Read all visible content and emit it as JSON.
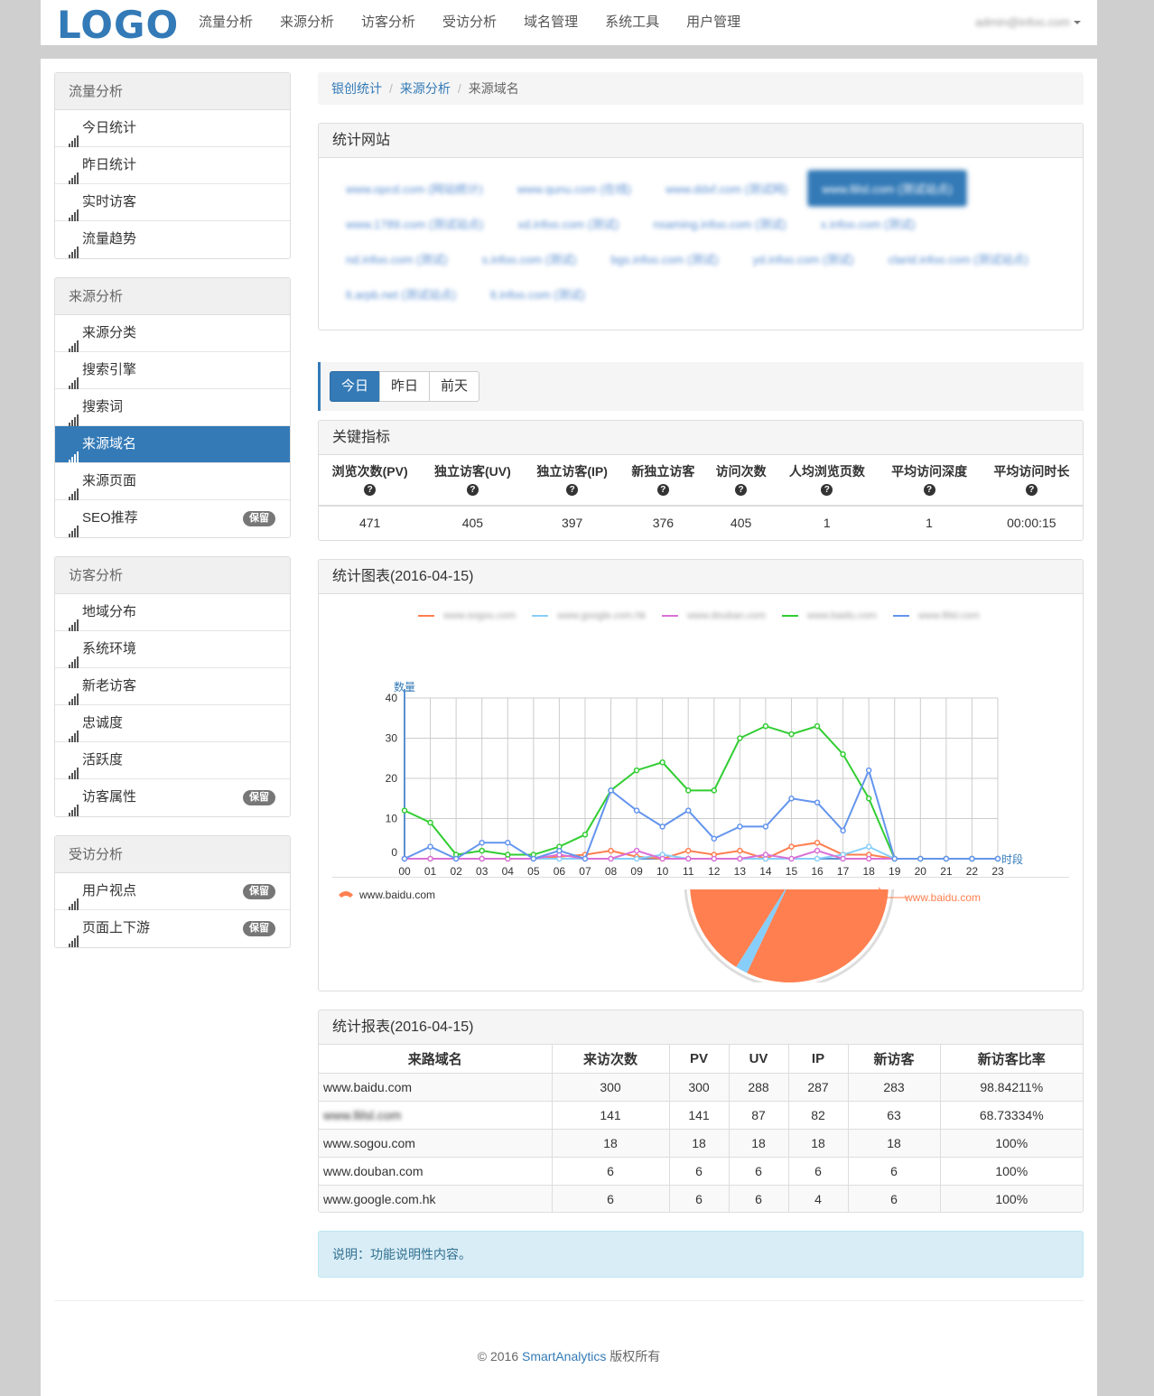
{
  "brand": {
    "logo": "LOGO"
  },
  "topnav": [
    "流量分析",
    "来源分析",
    "访客分析",
    "受访分析",
    "域名管理",
    "系统工具",
    "用户管理"
  ],
  "user": {
    "name": "admin@infoo.com"
  },
  "sidebar": [
    {
      "title": "流量分析",
      "items": [
        {
          "label": "今日统计"
        },
        {
          "label": "昨日统计"
        },
        {
          "label": "实时访客"
        },
        {
          "label": "流量趋势"
        }
      ]
    },
    {
      "title": "来源分析",
      "items": [
        {
          "label": "来源分类"
        },
        {
          "label": "搜索引擎"
        },
        {
          "label": "搜索词"
        },
        {
          "label": "来源域名",
          "active": true
        },
        {
          "label": "来源页面"
        },
        {
          "label": "SEO推荐",
          "badge": "保留"
        }
      ]
    },
    {
      "title": "访客分析",
      "items": [
        {
          "label": "地域分布"
        },
        {
          "label": "系统环境"
        },
        {
          "label": "新老访客"
        },
        {
          "label": "忠诚度"
        },
        {
          "label": "活跃度"
        },
        {
          "label": "访客属性",
          "badge": "保留"
        }
      ]
    },
    {
      "title": "受访分析",
      "items": [
        {
          "label": "用户视点",
          "badge": "保留"
        },
        {
          "label": "页面上下游",
          "badge": "保留"
        }
      ]
    }
  ],
  "breadcrumb": {
    "home": "银创统计",
    "section": "来源分析",
    "current": "来源域名"
  },
  "sites_panel": {
    "title": "统计网站",
    "sites": [
      "www.opcd.com (网站统计)",
      "www.qunu.com (在线)",
      "www.ddxf.com (测试网)",
      "www.llilsl.com (测试站点)",
      "www.1789.com (测试站点)",
      "xd.infoo.com (测试)",
      "nsaming.infoo.com (测试)",
      "x.infoo.com (测试)",
      "nd.infoo.com (测试)",
      "s.infoo.com (测试)",
      "bgs.infoo.com (测试)",
      "yd.infoo.com (测试)",
      "clarid.infoo.com (测试站点)",
      "lt.arpb.net (测试站点)",
      "lt.infoo.com (测试)"
    ],
    "active_index": 3
  },
  "day_tabs": [
    "今日",
    "昨日",
    "前天"
  ],
  "kpi": {
    "title": "关键指标",
    "headers": [
      "浏览次数(PV)",
      "独立访客(UV)",
      "独立访客(IP)",
      "新独立访客",
      "访问次数",
      "人均浏览页数",
      "平均访问深度",
      "平均访问时长"
    ],
    "values": [
      "471",
      "405",
      "397",
      "376",
      "405",
      "1",
      "1",
      "00:00:15"
    ]
  },
  "chart_panel": {
    "title": "统计图表(2016-04-15)"
  },
  "chart_data": [
    {
      "type": "line",
      "ylabel": "数量",
      "xlabel": "时段",
      "ylim": [
        0,
        40
      ],
      "yticks": [
        "0",
        "10",
        "20",
        "30",
        "40"
      ],
      "x": [
        "00",
        "01",
        "02",
        "03",
        "04",
        "05",
        "06",
        "07",
        "08",
        "09",
        "10",
        "11",
        "12",
        "13",
        "14",
        "15",
        "16",
        "17",
        "18",
        "19",
        "20",
        "21",
        "22",
        "23"
      ],
      "legend_position": "top",
      "series": [
        {
          "name": "www.sogou.com",
          "color": "#ff7f50",
          "values": [
            0,
            0,
            0,
            0,
            0,
            0,
            0.5,
            1,
            2,
            0.5,
            0,
            2,
            1,
            2,
            0,
            3,
            4,
            1,
            1,
            0,
            0,
            0,
            0,
            0
          ]
        },
        {
          "name": "www.google.com.hk",
          "color": "#87cefa",
          "values": [
            0,
            0,
            0,
            0,
            0,
            0,
            0,
            0,
            0,
            0,
            1,
            0,
            0,
            0,
            0,
            0,
            0,
            1,
            3,
            0,
            0,
            0,
            0,
            0
          ]
        },
        {
          "name": "www.douban.com",
          "color": "#da70d6",
          "values": [
            0,
            0,
            0,
            0,
            0,
            0,
            1,
            0,
            0,
            2,
            0,
            0,
            0,
            0,
            1,
            0,
            2,
            0,
            0,
            0,
            0,
            0,
            0,
            0
          ]
        },
        {
          "name": "www.baidu.com",
          "color": "#32cd32",
          "values": [
            12,
            9,
            1,
            2,
            1,
            1,
            3,
            6,
            17,
            22,
            24,
            17,
            17,
            30,
            33,
            31,
            33,
            26,
            15,
            0,
            0,
            0,
            0,
            0
          ]
        },
        {
          "name": "www.llilsl.com",
          "color": "#6495ed",
          "values": [
            0,
            3,
            0,
            4,
            4,
            0,
            2,
            0,
            17,
            12,
            8,
            12,
            5,
            8,
            8,
            15,
            14,
            7,
            22,
            0,
            0,
            0,
            0,
            0
          ]
        }
      ]
    },
    {
      "type": "pie",
      "legend_position": "top-left",
      "legend": [
        "www.baidu.com"
      ],
      "categories": [
        "www.baidu.com",
        "www.google.com.hk"
      ],
      "values": [
        300,
        6
      ],
      "colors": [
        "#ff7f50",
        "#87cefa"
      ],
      "slice_label": "www.baidu.com"
    }
  ],
  "report": {
    "title": "统计报表(2016-04-15)",
    "headers": [
      "来路域名",
      "来访次数",
      "PV",
      "UV",
      "IP",
      "新访客",
      "新访客比率"
    ],
    "rows": [
      [
        "www.baidu.com",
        "300",
        "300",
        "288",
        "287",
        "283",
        "98.84211%"
      ],
      [
        "www.llilsl.com",
        "141",
        "141",
        "87",
        "82",
        "63",
        "68.73334%"
      ],
      [
        "www.sogou.com",
        "18",
        "18",
        "18",
        "18",
        "18",
        "100%"
      ],
      [
        "www.douban.com",
        "6",
        "6",
        "6",
        "6",
        "6",
        "100%"
      ],
      [
        "www.google.com.hk",
        "6",
        "6",
        "6",
        "4",
        "6",
        "100%"
      ]
    ]
  },
  "alert": {
    "text": "说明：功能说明性内容。"
  },
  "footer": {
    "prefix": "© 2016 ",
    "brand": "SmartAnalytics",
    "suffix": " 版权所有"
  },
  "colors": {
    "primary": "#337ab7",
    "badge": "#777777",
    "alert_bg": "#d9edf7"
  }
}
